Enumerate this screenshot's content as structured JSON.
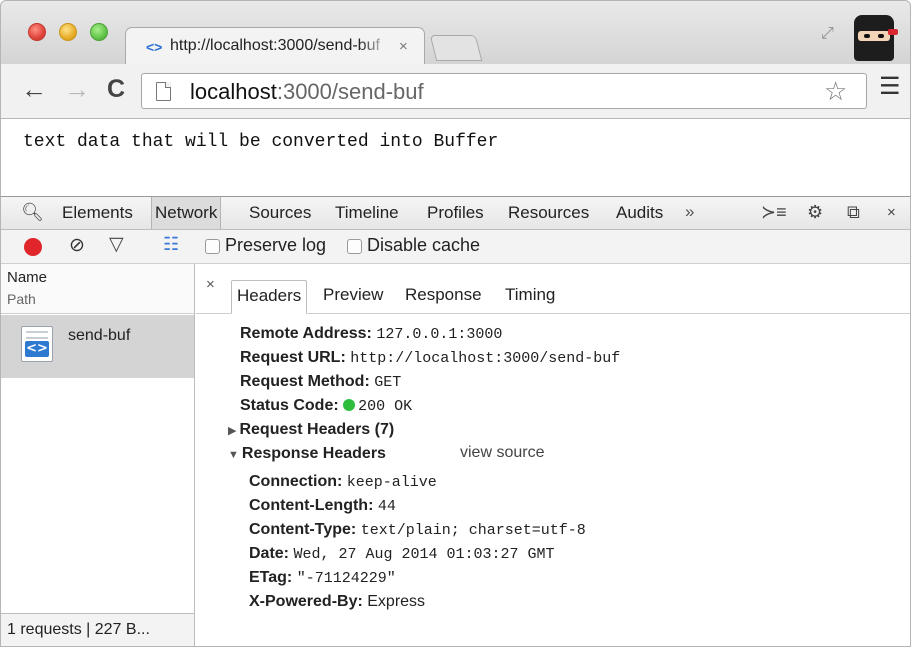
{
  "browser": {
    "tab": {
      "favicon_icon": "back-forward-code-icon",
      "title": "http://localhost:3000/send-buf",
      "close_glyph": "×"
    },
    "address": {
      "host": "localhost",
      "path": ":3000/send-buf"
    }
  },
  "page": {
    "text": "text data that will be converted into Buffer"
  },
  "devtools": {
    "tabs": [
      "Elements",
      "Network",
      "Sources",
      "Timeline",
      "Profiles",
      "Resources",
      "Audits"
    ],
    "active_tab": "Network",
    "more_glyph": "»",
    "network_toolbar": {
      "preserve_log": "Preserve log",
      "disable_cache": "Disable cache"
    },
    "request_list": {
      "header_name": "Name",
      "header_path": "Path",
      "requests": [
        {
          "name": "send-buf",
          "icon": "document-code-icon"
        }
      ],
      "footer": "1 requests | 227 B..."
    },
    "detail": {
      "close_glyph": "×",
      "tabs": [
        "Headers",
        "Preview",
        "Response",
        "Timing"
      ],
      "active_tab": "Headers",
      "general": [
        {
          "key": "Remote Address:",
          "value": "127.0.0.1:3000"
        },
        {
          "key": "Request URL:",
          "value": "http://localhost:3000/send-buf"
        },
        {
          "key": "Request Method:",
          "value": "GET"
        },
        {
          "key": "Status Code:",
          "value": "200 OK"
        }
      ],
      "status_color": "#2dbd3d",
      "request_headers_label": "Request Headers (7)",
      "response_headers_label": "Response Headers",
      "view_source": "view source",
      "response_headers": [
        {
          "key": "Connection:",
          "value": "keep-alive"
        },
        {
          "key": "Content-Length:",
          "value": "44"
        },
        {
          "key": "Content-Type:",
          "value": "text/plain; charset=utf-8"
        },
        {
          "key": "Date:",
          "value": "Wed, 27 Aug 2014 01:03:27 GMT"
        },
        {
          "key": "ETag:",
          "value": "\"-71124229\""
        },
        {
          "key": "X-Powered-By:",
          "value": "Express"
        }
      ]
    }
  },
  "colors": {
    "record": "#e0262b",
    "accent": "#2e7ad1"
  }
}
